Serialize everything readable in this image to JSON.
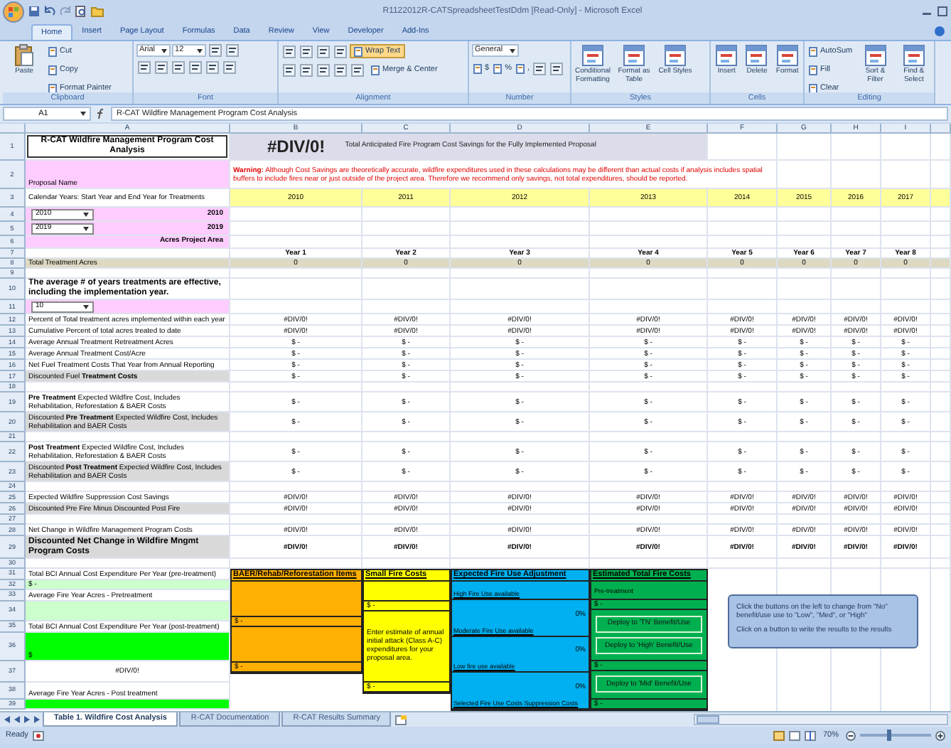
{
  "window": {
    "title": "R1122012R-CATSpreadsheetTestDdm [Read-Only] - Microsoft Excel"
  },
  "ribbon_tabs": [
    {
      "label": "Home",
      "selected": true
    },
    {
      "label": "Insert",
      "selected": false
    },
    {
      "label": "Page Layout",
      "selected": false
    },
    {
      "label": "Formulas",
      "selected": false
    },
    {
      "label": "Data",
      "selected": false
    },
    {
      "label": "Review",
      "selected": false
    },
    {
      "label": "View",
      "selected": false
    },
    {
      "label": "Developer",
      "selected": false
    },
    {
      "label": "Add-Ins",
      "selected": false
    }
  ],
  "ribbon_groups": [
    {
      "label": "Clipboard",
      "items": [
        {
          "kind": "large",
          "label": "Paste"
        },
        {
          "kind": "stack",
          "rows": [
            [
              {
                "kind": "small",
                "label": "Cut"
              }
            ],
            [
              {
                "kind": "small",
                "label": "Copy"
              }
            ],
            [
              {
                "kind": "small",
                "label": "Format Painter"
              }
            ]
          ]
        }
      ]
    },
    {
      "label": "Font",
      "items": [
        {
          "kind": "stack",
          "rows": [
            [
              {
                "kind": "field",
                "value": "Arial"
              },
              {
                "kind": "field",
                "value": "12"
              },
              {
                "kind": "icon"
              },
              {
                "kind": "icon"
              }
            ],
            [
              {
                "kind": "icon"
              },
              {
                "kind": "icon"
              },
              {
                "kind": "icon"
              },
              {
                "kind": "icon"
              },
              {
                "kind": "icon"
              },
              {
                "kind": "icon"
              }
            ]
          ]
        }
      ]
    },
    {
      "label": "Alignment",
      "items": [
        {
          "kind": "stack",
          "rows": [
            [
              {
                "kind": "icon"
              },
              {
                "kind": "icon"
              },
              {
                "kind": "icon"
              },
              {
                "kind": "icon"
              },
              {
                "kind": "toggle",
                "label": "Wrap Text",
                "on": true
              }
            ],
            [
              {
                "kind": "icon"
              },
              {
                "kind": "icon"
              },
              {
                "kind": "icon"
              },
              {
                "kind": "icon"
              },
              {
                "kind": "icon"
              },
              {
                "kind": "toggle",
                "label": "Merge & Center",
                "on": false
              }
            ]
          ]
        }
      ]
    },
    {
      "label": "Number",
      "items": [
        {
          "kind": "stack",
          "rows": [
            [
              {
                "kind": "field",
                "value": "General"
              }
            ],
            [
              {
                "kind": "small",
                "label": "$"
              },
              {
                "kind": "small",
                "label": "%"
              },
              {
                "kind": "small",
                "label": ","
              },
              {
                "kind": "icon"
              },
              {
                "kind": "icon"
              }
            ]
          ]
        }
      ]
    },
    {
      "label": "Styles",
      "items": [
        {
          "kind": "large",
          "label": "Conditional Formatting"
        },
        {
          "kind": "large",
          "label": "Format as Table"
        },
        {
          "kind": "large",
          "label": "Cell Styles"
        }
      ]
    },
    {
      "label": "Cells",
      "items": [
        {
          "kind": "large",
          "label": "Insert"
        },
        {
          "kind": "large",
          "label": "Delete"
        },
        {
          "kind": "large",
          "label": "Format"
        }
      ]
    },
    {
      "label": "Editing",
      "items": [
        {
          "kind": "stack",
          "rows": [
            [
              {
                "kind": "small",
                "label": "AutoSum"
              }
            ],
            [
              {
                "kind": "small",
                "label": "Fill"
              }
            ],
            [
              {
                "kind": "small",
                "label": "Clear"
              }
            ]
          ]
        },
        {
          "kind": "large",
          "label": "Sort & Filter"
        },
        {
          "kind": "large",
          "label": "Find & Select"
        }
      ]
    }
  ],
  "formula_bar": {
    "name_box": "A1",
    "formula": "R-CAT Wildfire Management Program Cost Analysis"
  },
  "columns": [
    "A",
    "B",
    "C",
    "D",
    "E",
    "F",
    "G",
    "H",
    "I"
  ],
  "rows": [
    {
      "number": "1",
      "kind": "title",
      "label": "R-CAT Wildfire Management Program Cost Analysis",
      "result": "#DIV/0!",
      "caption": "Total Anticipated Fire Program Cost Savings for the Fully Implemented Proposal"
    },
    {
      "number": "2",
      "kind": "warning",
      "label": "Proposal Name",
      "warning": "**Warning:** Although Cost Savings are theoretically accurate, wildfire expenditures used in these calculations may be different than actual costs if analysis includes spatial buffers to include fires near or just outside of the project area. Therefore we recommend only savings, not total expenditures, should be reported."
    },
    {
      "number": "3",
      "kind": "years",
      "label": "Calendar Years: Start Year and End Year for Treatments",
      "values": [
        "2010",
        "2011",
        "2012",
        "2013",
        "2014",
        "2015",
        "2016",
        "2017"
      ]
    },
    {
      "number": "4",
      "kind": "select",
      "value": "2010",
      "note": "2010"
    },
    {
      "number": "5",
      "kind": "select",
      "value": "2019",
      "note": "2019"
    },
    {
      "number": "6",
      "kind": "area",
      "note": "Acres Project Area"
    },
    {
      "number": "7",
      "kind": "year_labels",
      "values": [
        "Year 1",
        "Year 2",
        "Year 3",
        "Year 4",
        "Year 5",
        "Year 6",
        "Year 7",
        "Year 8"
      ]
    },
    {
      "number": "8",
      "kind": "total",
      "label": "Total Treatment Acres",
      "values": [
        "0",
        "0",
        "0",
        "0",
        "0",
        "0",
        "0",
        "0"
      ]
    },
    {
      "number": "9",
      "kind": "blank"
    },
    {
      "number": "10",
      "kind": "heading",
      "label": "The average # of years treatments are effective, including the implementation year."
    },
    {
      "number": "11",
      "kind": "pink_select",
      "value": "10"
    },
    {
      "number": "12",
      "kind": "plain",
      "label": "Percent of Total treatment acres implemented within each year",
      "values": [
        "#DIV/0!",
        "#DIV/0!",
        "#DIV/0!",
        "#DIV/0!",
        "#DIV/0!",
        "#DIV/0!",
        "#DIV/0!",
        "#DIV/0!"
      ]
    },
    {
      "number": "13",
      "kind": "plain",
      "label": "Cumulative Percent of total acres treated to date",
      "values": [
        "#DIV/0!",
        "#DIV/0!",
        "#DIV/0!",
        "#DIV/0!",
        "#DIV/0!",
        "#DIV/0!",
        "#DIV/0!",
        "#DIV/0!"
      ]
    },
    {
      "number": "14",
      "kind": "plain",
      "label": "Average Annual Treatment Retreatment Acres",
      "values": [
        "$ -",
        "$ -",
        "$ -",
        "$ -",
        "$ -",
        "$ -",
        "$ -",
        "$ -"
      ]
    },
    {
      "number": "15",
      "kind": "plain",
      "label": "Average Annual Treatment Cost/Acre",
      "values": [
        "$ -",
        "$ -",
        "$ -",
        "$ -",
        "$ -",
        "$ -",
        "$ -",
        "$ -"
      ]
    },
    {
      "number": "16",
      "kind": "plain",
      "label": "Net Fuel Treatment Costs That Year from Annual Reporting",
      "values": [
        "$ -",
        "$ -",
        "$ -",
        "$ -",
        "$ -",
        "$ -",
        "$ -",
        "$ -"
      ]
    },
    {
      "number": "17",
      "kind": "shaded",
      "label": "Discounted Fuel **Treatment Costs**",
      "values": [
        "$ -",
        "$ -",
        "$ -",
        "$ -",
        "$ -",
        "$ -",
        "$ -",
        "$ -"
      ]
    },
    {
      "number": "18",
      "kind": "blank"
    },
    {
      "number": "19",
      "kind": "plain",
      "label": "**Pre Treatment** Expected Wildfire Cost, Includes Rehabilitation, Reforestation & BAER Costs",
      "values": [
        "$ -",
        "$ -",
        "$ -",
        "$ -",
        "$ -",
        "$ -",
        "$ -",
        "$ -"
      ]
    },
    {
      "number": "20",
      "kind": "shaded",
      "label": "Discounted **Pre Treatment** Expected Wildfire Cost, Includes Rehabilitation and BAER Costs",
      "values": [
        "$ -",
        "$ -",
        "$ -",
        "$ -",
        "$ -",
        "$ -",
        "$ -",
        "$ -"
      ]
    },
    {
      "number": "21",
      "kind": "blank"
    },
    {
      "number": "22",
      "kind": "plain",
      "label": "**Post Treatment** Expected Wildfire Cost, Includes Rehabilitation, Reforestation & BAER Costs",
      "values": [
        "$ -",
        "$ -",
        "$ -",
        "$ -",
        "$ -",
        "$ -",
        "$ -",
        "$ -"
      ]
    },
    {
      "number": "23",
      "kind": "shaded",
      "label": "Discounted **Post Treatment** Expected Wildfire Cost, Includes Rehabilitation and BAER Costs",
      "values": [
        "$ -",
        "$ -",
        "$ -",
        "$ -",
        "$ -",
        "$ -",
        "$ -",
        "$ -"
      ]
    },
    {
      "number": "24",
      "kind": "blank"
    },
    {
      "number": "25",
      "kind": "plain",
      "label": "Expected Wildfire Suppression Cost Savings",
      "values": [
        "#DIV/0!",
        "#DIV/0!",
        "#DIV/0!",
        "#DIV/0!",
        "#DIV/0!",
        "#DIV/0!",
        "#DIV/0!",
        "#DIV/0!"
      ]
    },
    {
      "number": "26",
      "kind": "shaded",
      "label": "Discounted Pre Fire Minus Discounted Post Fire",
      "values": [
        "#DIV/0!",
        "#DIV/0!",
        "#DIV/0!",
        "#DIV/0!",
        "#DIV/0!",
        "#DIV/0!",
        "#DIV/0!",
        "#DIV/0!"
      ]
    },
    {
      "number": "27",
      "kind": "blank"
    },
    {
      "number": "28",
      "kind": "plain",
      "label": "Net Change in Wildfire Management Program Costs",
      "values": [
        "#DIV/0!",
        "#DIV/0!",
        "#DIV/0!",
        "#DIV/0!",
        "#DIV/0!",
        "#DIV/0!",
        "#DIV/0!",
        "#DIV/0!"
      ]
    },
    {
      "number": "29",
      "kind": "bold_shaded",
      "label": "Discounted Net Change in Wildfire Mngmt Program Costs",
      "values": [
        "#DIV/0!",
        "#DIV/0!",
        "#DIV/0!",
        "#DIV/0!",
        "#DIV/0!",
        "#DIV/0!",
        "#DIV/0!",
        "#DIV/0!"
      ]
    },
    {
      "number": "30",
      "kind": "blank"
    }
  ],
  "lower_rows": [
    {
      "number": "31",
      "kind": "label",
      "text": "Total BCI Annual Cost Expenditure Per Year (pre-treatment)"
    },
    {
      "number": "32",
      "kind": "light",
      "text": "$ -"
    },
    {
      "number": "33",
      "kind": "label",
      "text": "Average Fire Year Acres - Pretreatment"
    },
    {
      "number": "34",
      "kind": "light_block"
    },
    {
      "number": "35",
      "kind": "label",
      "text": "Total BCI Annual Cost Expenditure Per Year (post-treatment)"
    },
    {
      "number": "36",
      "kind": "bright",
      "text": "$"
    },
    {
      "number": "37",
      "kind": "result",
      "text": "#DIV/0!"
    },
    {
      "number": "38",
      "kind": "label_low",
      "text": "Average Fire Year Acres - Post treatment"
    },
    {
      "number": "39",
      "kind": "bright_block"
    }
  ],
  "panels": [
    {
      "title": "BAER/Rehab/Reforestation Items",
      "color": "#ffb000",
      "items": [
        {
          "kind": "value",
          "text": "$ -"
        },
        {
          "kind": "value",
          "text": "$ -"
        }
      ]
    },
    {
      "title": "Small Fire Costs",
      "color": "#ffff00",
      "items": [
        {
          "kind": "value",
          "text": "$ -"
        },
        {
          "kind": "note",
          "text": "Enter estimate of annual initial attack (Class A-C) expenditures for your proposal area."
        },
        {
          "kind": "value",
          "text": "$ -"
        }
      ]
    },
    {
      "title": "Expected Fire Use Adjustment",
      "color": "#00b0f0",
      "items": [
        {
          "kind": "label",
          "text": "High Fire Use available"
        },
        {
          "kind": "pct",
          "text": "0%"
        },
        {
          "kind": "label",
          "text": "Moderate Fire Use available"
        },
        {
          "kind": "pct",
          "text": "0%"
        },
        {
          "kind": "label",
          "text": "Low fire use available"
        },
        {
          "kind": "pct",
          "text": "0%"
        },
        {
          "kind": "label",
          "text": "Selected Fire Use Costs Suppression Costs"
        }
      ]
    },
    {
      "title": "Estimated Total Fire Costs",
      "color": "#00b050",
      "items": [
        {
          "kind": "subhead",
          "text": "Pre-treatment"
        },
        {
          "kind": "value",
          "text": "$ -"
        },
        {
          "kind": "button",
          "text": "Deploy to 'TN' Benefit/Use"
        },
        {
          "kind": "button",
          "text": "Deploy to 'High' Benefit/Use"
        },
        {
          "kind": "value",
          "text": "$ -"
        },
        {
          "kind": "button",
          "text": "Deploy to 'Mid' Benefit/Use"
        },
        {
          "kind": "value",
          "text": "$ -"
        }
      ]
    }
  ],
  "callout": {
    "lines": [
      "Click the buttons on the left to change from \"No\" benefit/use use to \"Low\", \"Med\", or \"High\"",
      "Click on a button to write the results to the results"
    ]
  },
  "sheet_tabs": [
    {
      "label": "Table 1. Wildfire Cost Analysis",
      "selected": true
    },
    {
      "label": "R-CAT Documentation",
      "selected": false
    },
    {
      "label": "R-CAT Results Summary",
      "selected": false
    }
  ],
  "status_bar": {
    "status": "Ready",
    "zoom": "70%",
    "zoom_slider": {
      "level": 0.4
    }
  }
}
